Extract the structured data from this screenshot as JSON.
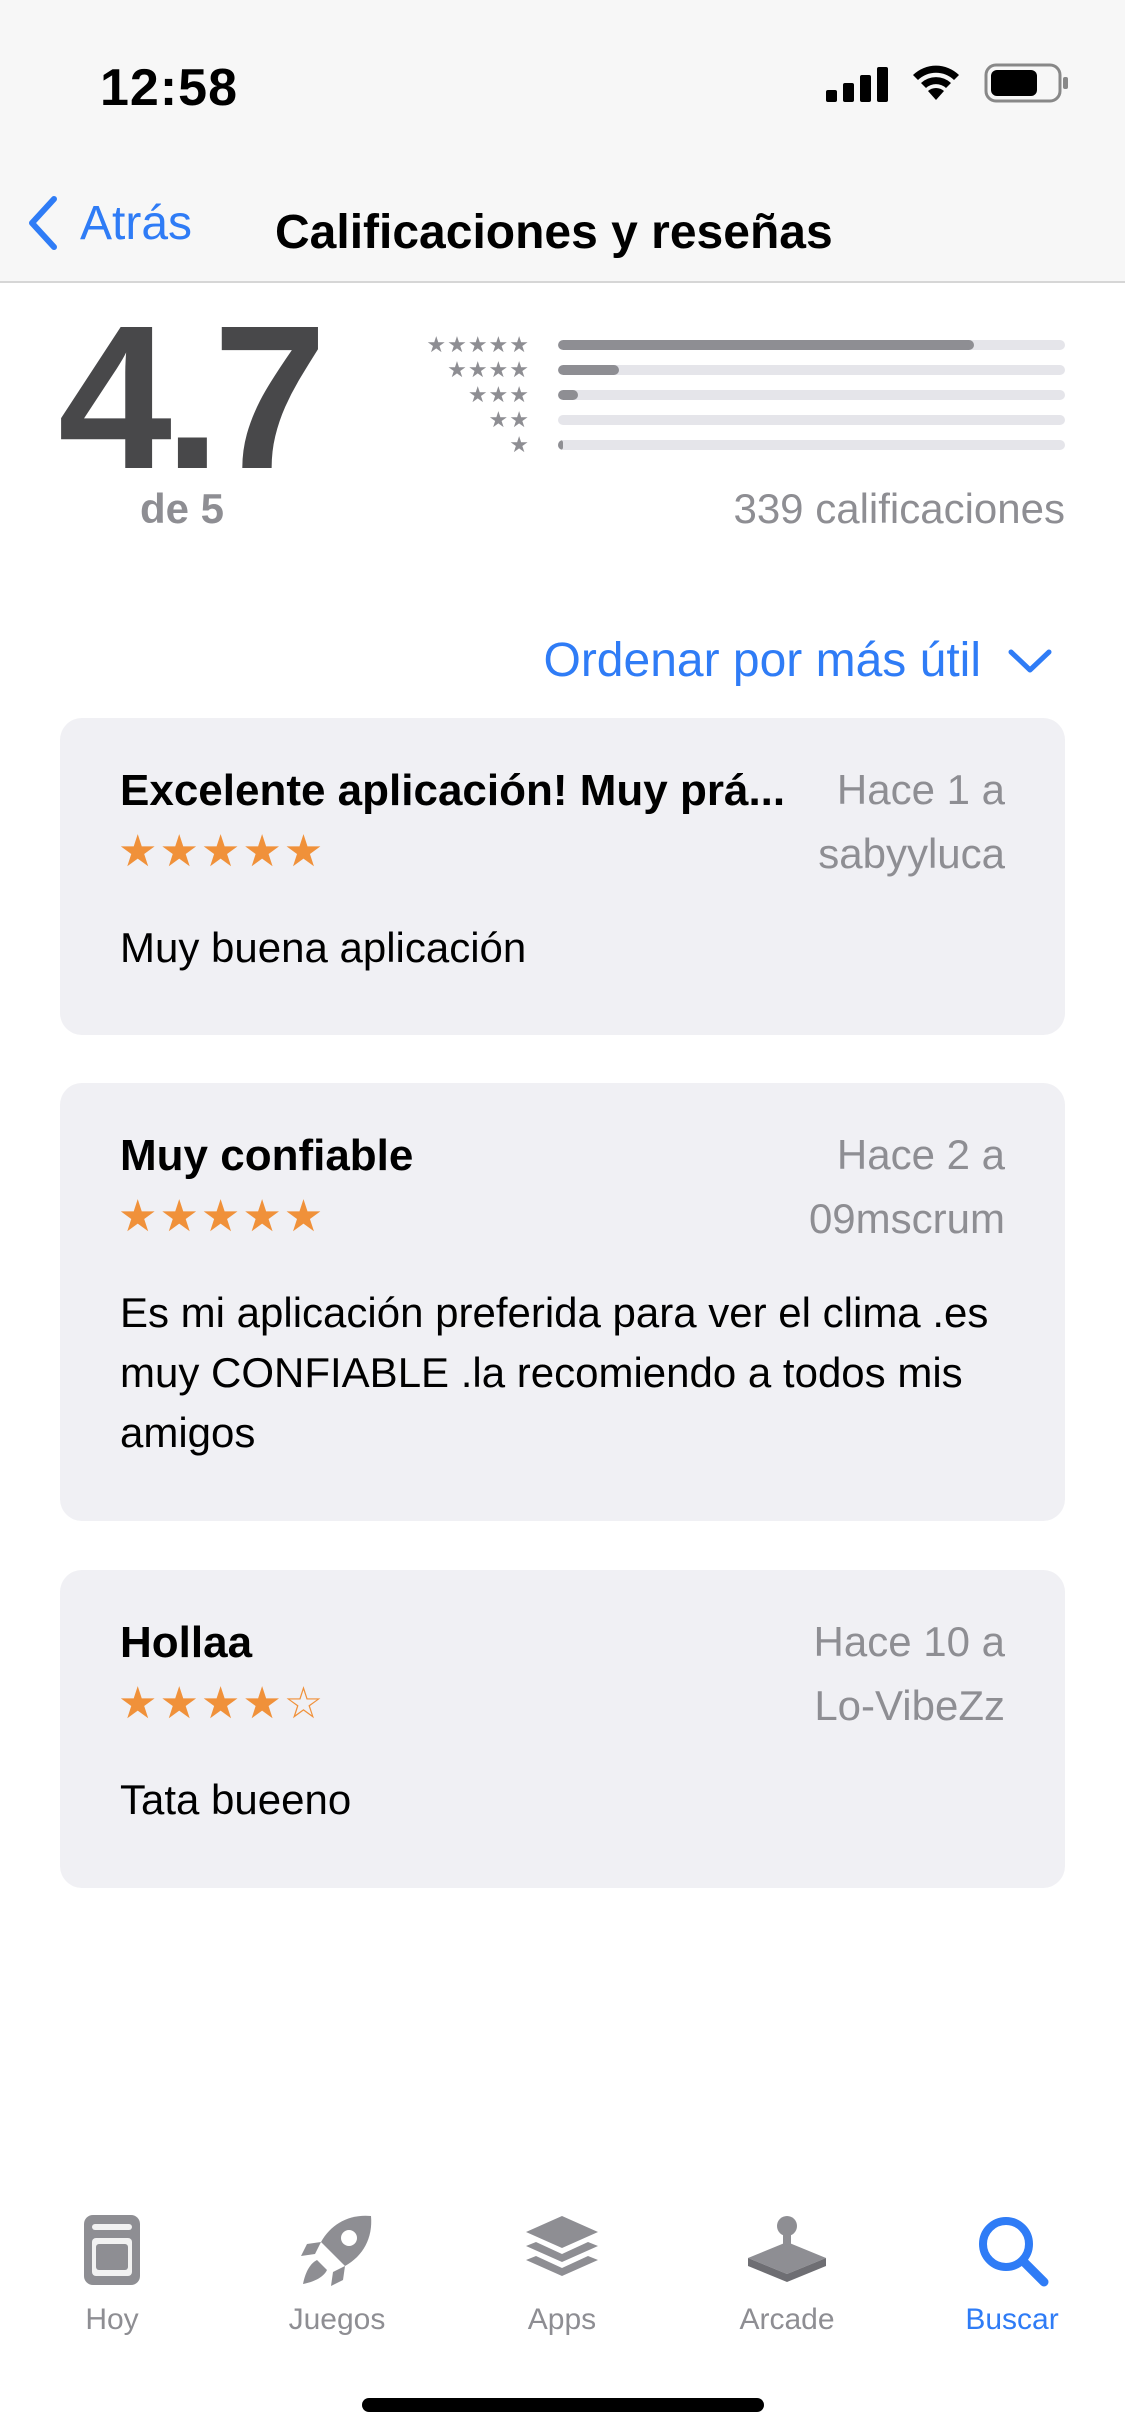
{
  "status_bar": {
    "time": "12:58",
    "icons": [
      "cellular-signal-icon",
      "wifi-icon",
      "battery-icon"
    ]
  },
  "nav": {
    "back_label": "Atrás",
    "title": "Calificaciones y reseñas"
  },
  "ratings": {
    "average": "4.7",
    "out_of": "de 5",
    "count_label": "339 calificaciones",
    "histogram": [
      {
        "stars": "★★★★★",
        "fraction": 0.82
      },
      {
        "stars": "★★★★",
        "fraction": 0.12
      },
      {
        "stars": "★★★",
        "fraction": 0.04
      },
      {
        "stars": "★★",
        "fraction": 0.0
      },
      {
        "stars": "★",
        "fraction": 0.01
      }
    ]
  },
  "sort": {
    "label": "Ordenar por más útil"
  },
  "reviews": [
    {
      "title": "Excelente aplicación! Muy prá...",
      "date": "Hace 1 a",
      "author": "sabyyluca",
      "rating": 5,
      "stars": "★★★★★",
      "body": "Muy buena aplicación"
    },
    {
      "title": "Muy confiable",
      "date": "Hace 2 a",
      "author": "09mscrum",
      "rating": 5,
      "stars": "★★★★★",
      "body": "Es mi aplicación preferida para ver el clima .es muy CONFIABLE .la recomiendo a todos mis amigos"
    },
    {
      "title": "Hollaa",
      "date": "Hace 10 a",
      "author": "Lo-VibeZz",
      "rating": 4,
      "stars": "★★★★☆",
      "body": "Tata bueeno"
    }
  ],
  "tab_bar": {
    "tabs": [
      {
        "label": "Hoy",
        "icon": "today-icon",
        "active": false
      },
      {
        "label": "Juegos",
        "icon": "rocket-icon",
        "active": false
      },
      {
        "label": "Apps",
        "icon": "apps-stack-icon",
        "active": false
      },
      {
        "label": "Arcade",
        "icon": "arcade-joystick-icon",
        "active": false
      },
      {
        "label": "Buscar",
        "icon": "search-icon",
        "active": true
      }
    ]
  },
  "colors": {
    "accent": "#2f7cf6",
    "star": "#f0913a",
    "secondary_text": "#8e8e93",
    "card_background": "#f0f0f4"
  }
}
